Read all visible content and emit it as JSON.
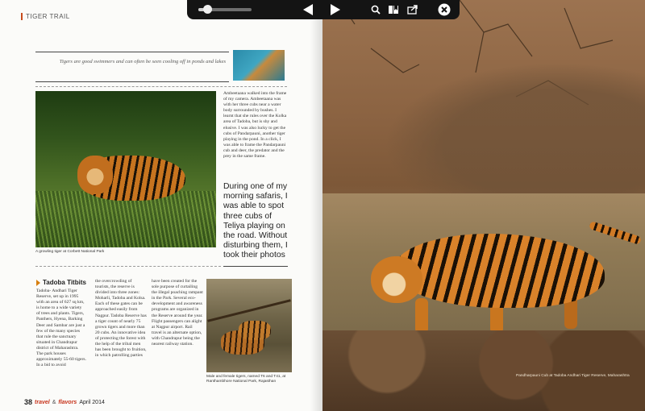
{
  "toolbar": {
    "scrubber_progress": 0.1,
    "icons": [
      "prev-arrow",
      "next-arrow",
      "search",
      "bookmarks",
      "share",
      "close"
    ]
  },
  "left_page": {
    "section_tag": "TIGER TRAIL",
    "pull_quote": "Tigers are good swimmers and can often be seen cooling off in ponds and lakes",
    "main_photo_caption": "A growling tiger at Corbett National Park",
    "column_text": "Ambeetaana walked into the frame of my camera. Ambeetaana was with her three cubs near a water body surrounded by bushes. I learnt that she rules over the Kolka area of Tadoba, but is shy and elusive. I was also lucky to get the cubs of Pandarpauni, another tiger playing in the pond. In a click, I was able to frame the Pandarpauni cub and deer, the predator and the prey in the same frame.",
    "big_quote": "During one of my morning safaris, I was able to spot three cubs of Teliya playing on the road. Without disturbing them, I took their photos",
    "titbits_title": "Tadoba Titbits",
    "titbits_col1": "Tadoba- Andhari Tiger Reserve, set up in 1995 with an area of  627 sq km, is home to a wide variety of trees and plants. Tigers, Panthers, Hyena, Barking Deer and Sambar are just a few of the many species that rule the sanctuary situated in Chandrapur district of Maharashtra. The park houses approximately 55-60 tigers. In a bid to avoid",
    "titbits_col2": "the overcrowding of tourists, the reserve is divided into three zones: Moharli, Tadoba and Kolsa. Each of these gates can be approached easily from Nagpur. Tadoba Reserve has a tiger count of nearly 75 grown tigers and more than 20 cubs. An innovative idea of protecting the forest with the help of the tribal men has been brought to fruition, in which patrolling parties",
    "titbits_col3": "have been created for the sole purpose of curtailing the illegal poaching rampant in the Park. Several eco-development and awareness programs are organized in the Reserve around the year. Flight passengers can alight at Nagpur airport. Rail travel is an alternate option, with Chandrapur being the nearest railway station.",
    "pair_photo_caption": "Male and female tigers, named T6 and T41, at Ranthambhore National Park, Rajasthan",
    "footer": {
      "page_number": "38",
      "magazine_travel": "travel",
      "magazine_amp": "&",
      "magazine_flavors": "flavors",
      "issue": "April 2014"
    }
  },
  "right_page": {
    "photo_caption": "Pandharpauni Cub at Tadoba Andhari Tiger Reserve, Maharashtra"
  }
}
